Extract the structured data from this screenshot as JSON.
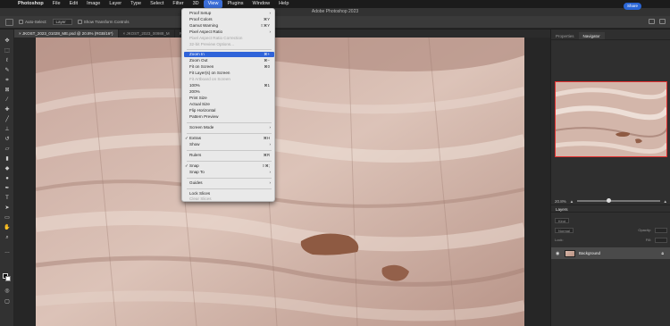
{
  "menubar": {
    "items": [
      "Photoshop",
      "File",
      "Edit",
      "Image",
      "Layer",
      "Type",
      "Select",
      "Filter",
      "3D",
      "View",
      "Plugins",
      "Window",
      "Help"
    ],
    "active": "View"
  },
  "window": {
    "title": "Adobe Photoshop 2023"
  },
  "options": {
    "auto_select_label": "Auto-Select:",
    "auto_select_value": "Layer",
    "transform_label": "Show Transform Controls",
    "share_label": "Share"
  },
  "tabs": [
    {
      "label": "× JKOST_2023_01028_ME.psd @ 20.8% (RGB/16*)",
      "active": true
    },
    {
      "label": "× JKOST_2023_00988_M",
      "active": false
    },
    {
      "label": "RGB/16*)",
      "active": false
    }
  ],
  "view_menu": {
    "items": [
      {
        "label": "Proof Setup",
        "shortcut": "",
        "arrow": true,
        "disabled": false,
        "check": false
      },
      {
        "label": "Proof Colors",
        "shortcut": "⌘Y",
        "arrow": false,
        "disabled": false,
        "check": false
      },
      {
        "label": "Gamut Warning",
        "shortcut": "⇧⌘Y",
        "arrow": false,
        "disabled": false,
        "check": false
      },
      {
        "label": "Pixel Aspect Ratio",
        "shortcut": "",
        "arrow": true,
        "disabled": false,
        "check": false
      },
      {
        "label": "Pixel Aspect Ratio Correction",
        "shortcut": "",
        "arrow": false,
        "disabled": true,
        "check": false
      },
      {
        "label": "32-bit Preview Options...",
        "shortcut": "",
        "arrow": false,
        "disabled": true,
        "check": false
      },
      {
        "label": "Zoom In",
        "shortcut": "⌘+",
        "arrow": false,
        "disabled": false,
        "check": false,
        "highlight": true
      },
      {
        "label": "Zoom Out",
        "shortcut": "⌘−",
        "arrow": false,
        "disabled": false,
        "check": false
      },
      {
        "label": "Fit on Screen",
        "shortcut": "⌘0",
        "arrow": false,
        "disabled": false,
        "check": false
      },
      {
        "label": "Fit Layer(s) on Screen",
        "shortcut": "",
        "arrow": false,
        "disabled": false,
        "check": false
      },
      {
        "label": "Fit Artboard on Screen",
        "shortcut": "",
        "arrow": false,
        "disabled": true,
        "check": false
      },
      {
        "label": "100%",
        "shortcut": "⌘1",
        "arrow": false,
        "disabled": false,
        "check": false
      },
      {
        "label": "200%",
        "shortcut": "",
        "arrow": false,
        "disabled": false,
        "check": false
      },
      {
        "label": "Print Size",
        "shortcut": "",
        "arrow": false,
        "disabled": false,
        "check": false
      },
      {
        "label": "Actual Size",
        "shortcut": "",
        "arrow": false,
        "disabled": false,
        "check": false
      },
      {
        "label": "Flip Horizontal",
        "shortcut": "",
        "arrow": false,
        "disabled": false,
        "check": false
      },
      {
        "label": "Pattern Preview",
        "shortcut": "",
        "arrow": false,
        "disabled": false,
        "check": false
      },
      {
        "label": "Screen Mode",
        "shortcut": "",
        "arrow": true,
        "disabled": false,
        "check": false
      },
      {
        "label": "Extras",
        "shortcut": "⌘H",
        "arrow": false,
        "disabled": false,
        "check": true
      },
      {
        "label": "Show",
        "shortcut": "",
        "arrow": true,
        "disabled": false,
        "check": false
      },
      {
        "label": "Rulers",
        "shortcut": "⌘R",
        "arrow": false,
        "disabled": false,
        "check": false
      },
      {
        "label": "Snap",
        "shortcut": "⇧⌘;",
        "arrow": false,
        "disabled": false,
        "check": true
      },
      {
        "label": "Snap To",
        "shortcut": "",
        "arrow": true,
        "disabled": false,
        "check": false
      },
      {
        "label": "Guides",
        "shortcut": "",
        "arrow": true,
        "disabled": false,
        "check": false
      },
      {
        "label": "Lock Slices",
        "shortcut": "",
        "arrow": false,
        "disabled": false,
        "check": false
      },
      {
        "label": "Clear Slices",
        "shortcut": "",
        "arrow": false,
        "disabled": true,
        "check": false
      }
    ]
  },
  "panels": {
    "tabs": [
      "Properties",
      "Navigator"
    ],
    "active_tab": "Navigator",
    "zoom_value": "20.8%",
    "layers_title": "Layers",
    "kind_label": "Kind",
    "normal_label": "Normal",
    "opacity_label": "Opacity:",
    "lock_label": "Lock:",
    "fill_label": "Fill:",
    "layer_name": "Background"
  },
  "colors": {
    "accent": "#2f63d9",
    "navigator_box": "#e3302f",
    "share": "#2a66d6"
  }
}
